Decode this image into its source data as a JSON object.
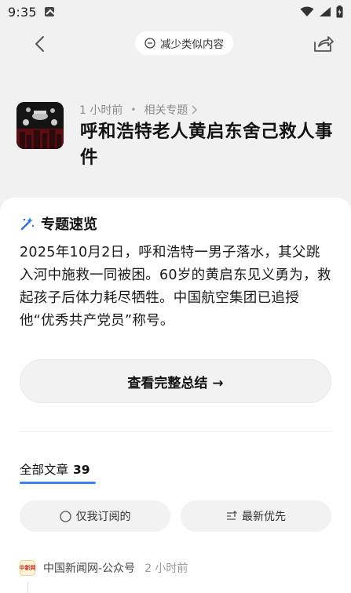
{
  "status_bar": {
    "time": "9:35"
  },
  "header": {
    "reduce_similar_label": "减少类似内容"
  },
  "topic": {
    "time_ago": "1 小时前",
    "related_label": "相关专题",
    "title": "呼和浩特老人黄启东舍己救人事件"
  },
  "overview": {
    "heading": "专题速览",
    "text": "2025年10月2日，呼和浩特一男子落水，其父跳入河中施救一同被困。60岁的黄启东见义勇为，救起孩子后体力耗尽牺牲。中国航空集团已追授他“优秀共产党员”称号。",
    "full_summary_label": "查看完整总结 →"
  },
  "articles": {
    "tab_label": "全部文章",
    "count": "39",
    "filter_subscribed_label": "仅我订阅的",
    "filter_latest_label": "最新优先",
    "items": [
      {
        "source": "中国新闻网-公众号",
        "time_ago": "2 小时前",
        "logo_text": "中新网"
      }
    ]
  },
  "colors": {
    "accent": "#3b82f6",
    "background": "#f1f1f1",
    "card": "#ffffff",
    "pill": "#f2f2f2"
  }
}
